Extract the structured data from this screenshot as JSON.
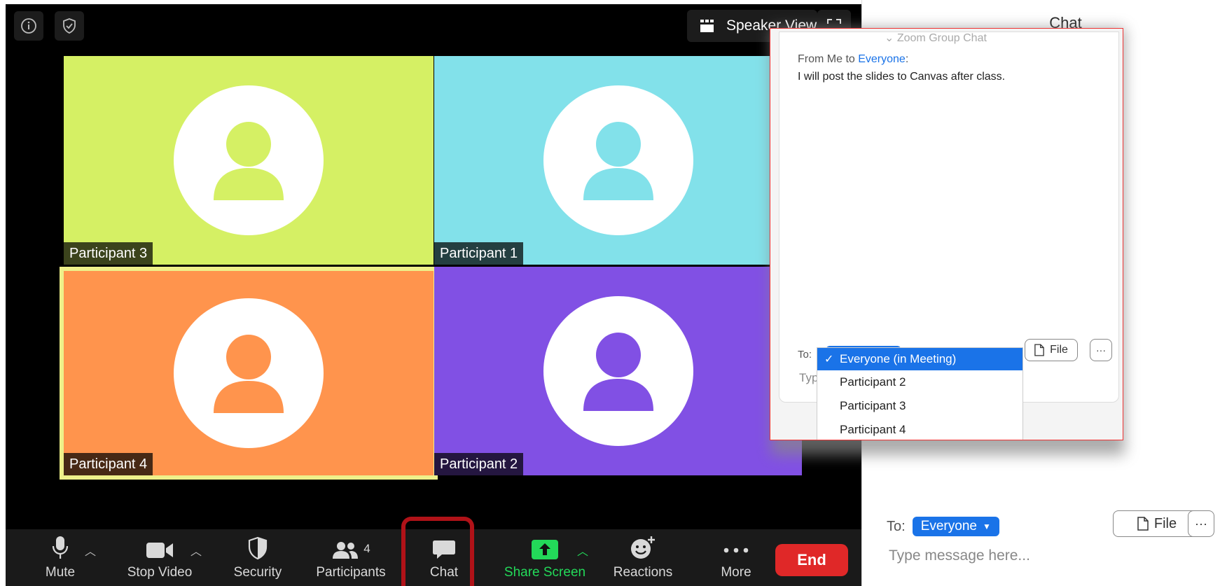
{
  "top_bar": {
    "info_icon": "info-icon",
    "security_icon": "shield-check-icon",
    "speaker_view_label": "Speaker View"
  },
  "tiles": [
    {
      "name": "Participant 3",
      "color": "#d5f064"
    },
    {
      "name": "Participant 1",
      "color": "#82e1ea"
    },
    {
      "name": "Participant 4",
      "color": "#ff944d"
    },
    {
      "name": "Participant 2",
      "color": "#8150e4"
    }
  ],
  "toolbar": {
    "mute_label": "Mute",
    "stop_video_label": "Stop Video",
    "security_label": "Security",
    "participants_label": "Participants",
    "participants_count": "4",
    "chat_label": "Chat",
    "share_screen_label": "Share Screen",
    "reactions_label": "Reactions",
    "more_label": "More",
    "end_label": "End"
  },
  "chat_panel": {
    "title": "Chat",
    "to_label": "To:",
    "recipient": "Everyone",
    "file_label": "File",
    "more_label": "···",
    "input_placeholder": "Type message here..."
  },
  "popup": {
    "ghost_header": "Zoom Group Chat",
    "message": {
      "from_prefix": "From Me to ",
      "recipient": "Everyone",
      "suffix": ":",
      "text": "I will post the slides to Canvas after class."
    },
    "to_label": "To:",
    "file_label": "File",
    "more_label": "···",
    "typing_partial": "Typ",
    "dropdown_options": [
      {
        "label": "Everyone (in Meeting)",
        "selected": true
      },
      {
        "label": "Participant 2",
        "selected": false
      },
      {
        "label": "Participant 3",
        "selected": false
      },
      {
        "label": "Participant 4",
        "selected": false
      }
    ]
  },
  "colors": {
    "accent_blue": "#1a73e8",
    "end_red": "#e02828",
    "share_green": "#23d959",
    "highlight_red": "#b01218"
  }
}
